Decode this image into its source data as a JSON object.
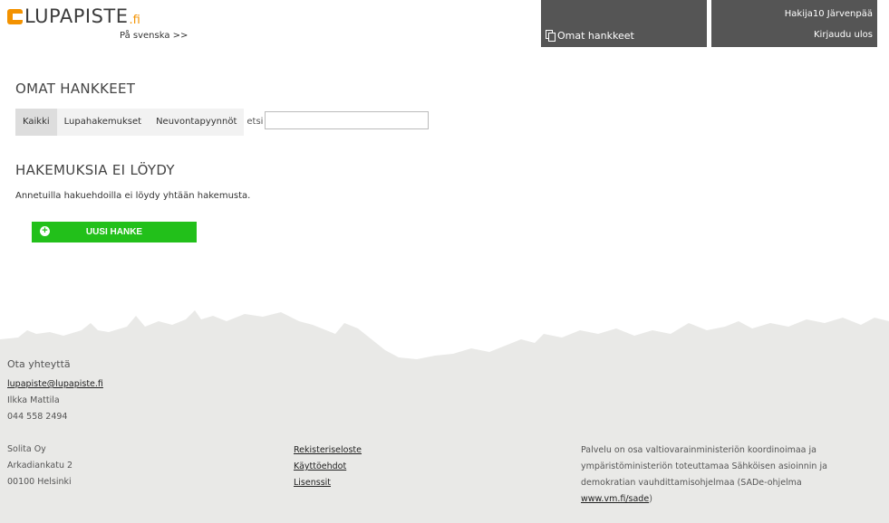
{
  "header": {
    "logo_text": "LUPAPISTE",
    "logo_suffix": ".fi",
    "language_link": "På svenska >>",
    "nav_projects": "Omat hankkeet",
    "user_name": "Hakija10 Järvenpää",
    "logout": "Kirjaudu ulos"
  },
  "main": {
    "title": "OMAT HANKKEET",
    "tabs": [
      {
        "label": "Kaikki",
        "active": true
      },
      {
        "label": "Lupahakemukset",
        "active": false
      },
      {
        "label": "Neuvontapyynnöt",
        "active": false
      }
    ],
    "search_label": "etsi",
    "search_value": "",
    "empty_title": "HAKEMUKSIA EI LÖYDY",
    "empty_text": "Annetuilla hakuehdoilla ei löydy yhtään hakemusta.",
    "new_button": "UUSI HANKE"
  },
  "footer": {
    "contact_title": "Ota yhteyttä",
    "email": "lupapiste@lupapiste.fi",
    "contact_name": "Ilkka Mattila",
    "phone": "044 558 2494",
    "company": "Solita Oy",
    "street": "Arkadiankatu 2",
    "city": "00100 Helsinki",
    "links": [
      "Rekisteriseloste",
      "Käyttöehdot",
      "Lisenssit"
    ],
    "about_lines": [
      "Palvelu on osa valtiovarainministeriön koordinoimaa ja",
      "ympäristöministeriön toteuttamaa Sähköisen asioinnin ja",
      "demokratian vauhdittamisohjelmaa (SADe-ohjelma"
    ],
    "about_link": "www.vm.fi/sade",
    "about_close": ")"
  },
  "colors": {
    "accent_orange": "#f39200",
    "nav_bg": "#555555",
    "button_green": "#22c01a",
    "footer_bg": "#e9e9e7"
  },
  "icons": {
    "nav_projects": "documents-icon",
    "new_button": "plus-circle-icon"
  }
}
